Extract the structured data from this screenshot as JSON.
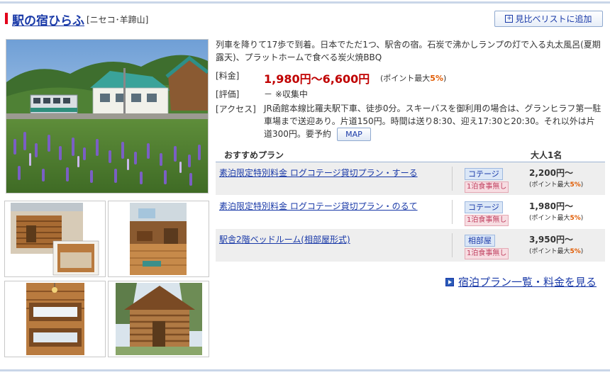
{
  "header": {
    "hotel_name": "駅の宿ひらふ",
    "area": "[ニセコ･羊蹄山]",
    "compare_button": "見比べリストに追加",
    "plus_glyph": "+"
  },
  "description": "列車を降りて17歩で到着。日本でただ1つ、駅舎の宿。石炭で沸かしランプの灯で入る丸太風呂(夏期露天)、プラットホームで食べる炭火焼BBQ",
  "info": {
    "price_label": "[料金]",
    "price": "1,980円～6,600円",
    "points_prefix": "(ポイント最大",
    "points_pct": "5%",
    "points_suffix": ")",
    "rating_label": "[評価]",
    "rating": "－ ※収集中",
    "access_label": "[アクセス]",
    "access": "JR函館本線比羅夫駅下車、徒歩0分。スキーバスを御利用の場合は、グランヒラフ第一駐車場まで送迎あり。片道150円。時間は送り8:30、迎え17:30と20:30。それ以外は片道300円。要予約",
    "map_button": "MAP"
  },
  "plans": {
    "col_plan": "おすすめプラン",
    "col_price": "大人1名",
    "points_prefix": "(ポイント最大",
    "points_pct": "5%",
    "points_suffix": ")",
    "rows": [
      {
        "name": "素泊限定特別料金 ログコテージ貸切プラン・すーる",
        "room": "コテージ",
        "meal": "1泊食事無し",
        "price": "2,200円～"
      },
      {
        "name": "素泊限定特別料金 ログコテージ貸切プラン・のるて",
        "room": "コテージ",
        "meal": "1泊食事無し",
        "price": "1,980円～"
      },
      {
        "name": "駅舎2階ベッドルーム(相部屋形式)",
        "room": "相部屋",
        "meal": "1泊食事無し",
        "price": "3,950円～"
      }
    ]
  },
  "all_plans_link": "宿泊プラン一覧・料金を見る",
  "colors": {
    "link": "#1a3aa8",
    "price_red": "#c00000",
    "accent_red": "#e2001a",
    "points_orange": "#e05a00",
    "room_tag_bg": "#dbe7f7",
    "meal_tag_bg": "#f7dde2"
  }
}
